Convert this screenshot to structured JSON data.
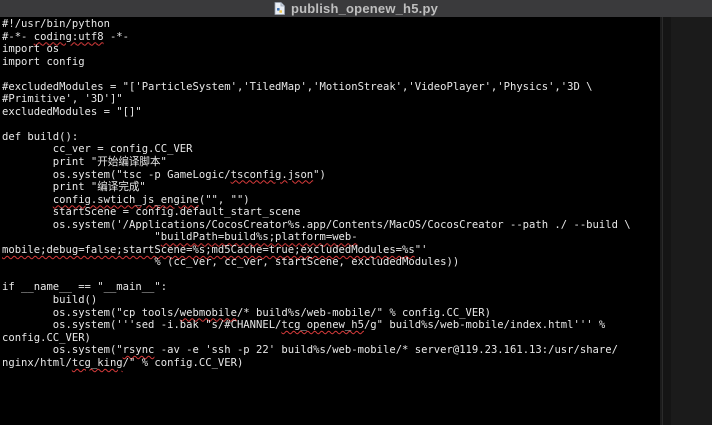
{
  "window": {
    "title": "publish_openew_h5.py",
    "title_icon": "python-file-icon"
  },
  "editor": {
    "lines": [
      "#!/usr/bin/python",
      "#-*- coding:utf8 -*-",
      "import os",
      "import config",
      "",
      "#excludedModules = \"['ParticleSystem','TiledMap','MotionStreak','VideoPlayer','Physics','3D \\",
      "#Primitive', '3D']\"",
      "excludedModules = \"[]\"",
      "",
      "def build():",
      "        cc_ver = config.CC_VER",
      "        print \"开始编译脚本\"",
      "        os.system(\"tsc -p GameLogic/tsconfig.json\")",
      "        print \"编译完成\"",
      "        config.swtich_js_engine(\"\", \"\")",
      "        startScene = config.default_start_scene",
      "        os.system('/Applications/CocosCreator%s.app/Contents/MacOS/CocosCreator --path ./ --build \\",
      "                        \"buildPath=build%s;platform=web-",
      "mobile;debug=false;startScene=%s;md5Cache=true;excludedModules=%s\"'",
      "                        % (cc_ver, cc_ver, startScene, excludedModules))",
      "",
      "if __name__ == \"__main__\":",
      "        build()",
      "        os.system(\"cp tools/webmobile/* build%s/web-mobile/\" % config.CC_VER)",
      "        os.system('''sed -i.bak \"s/#CHANNEL/tcg_openew_h5/g\" build%s/web-mobile/index.html''' %",
      "config.CC_VER)",
      "        os.system(\"rsync -av -e 'ssh -p 22' build%s/web-mobile/* server@119.23.161.13:/usr/share/",
      "nginx/html/tcg_king/\" % config.CC_VER)"
    ]
  },
  "theme": {
    "background": "#000000",
    "text": "#e8e8e8",
    "titlebar": "#3a3a3c",
    "spellcheck_underline": "#d83b3b"
  }
}
